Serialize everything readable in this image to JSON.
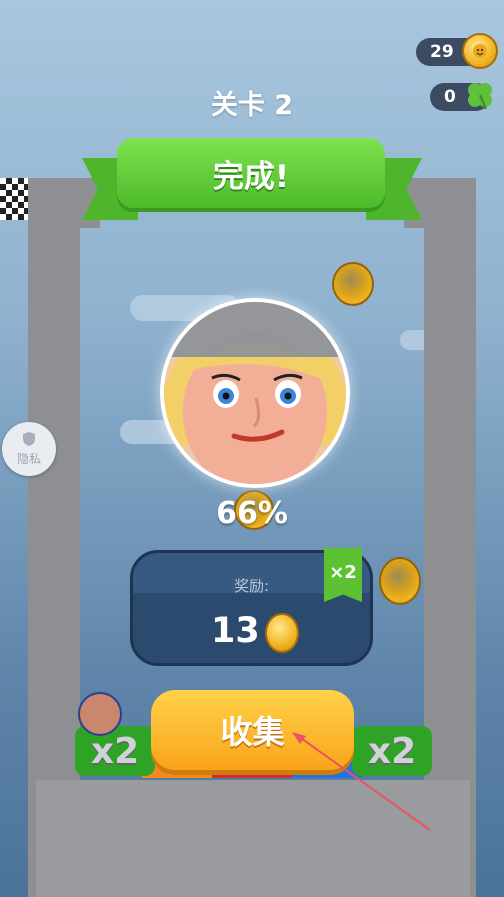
{
  "hud": {
    "coins": "29",
    "clovers": "0"
  },
  "level": {
    "prefix": "关卡",
    "number": "2"
  },
  "banner": {
    "text": "完成!"
  },
  "result": {
    "percent": "66%"
  },
  "reward": {
    "label": "奖励:",
    "amount": "13",
    "multiplier_tag": "×2"
  },
  "collect_button": {
    "label": "收集"
  },
  "multiplier_bars": {
    "left": "x2",
    "right": "x2"
  },
  "privacy": {
    "label": "隐私"
  },
  "icons": [
    "coin-icon",
    "clover-icon",
    "shield-icon"
  ]
}
